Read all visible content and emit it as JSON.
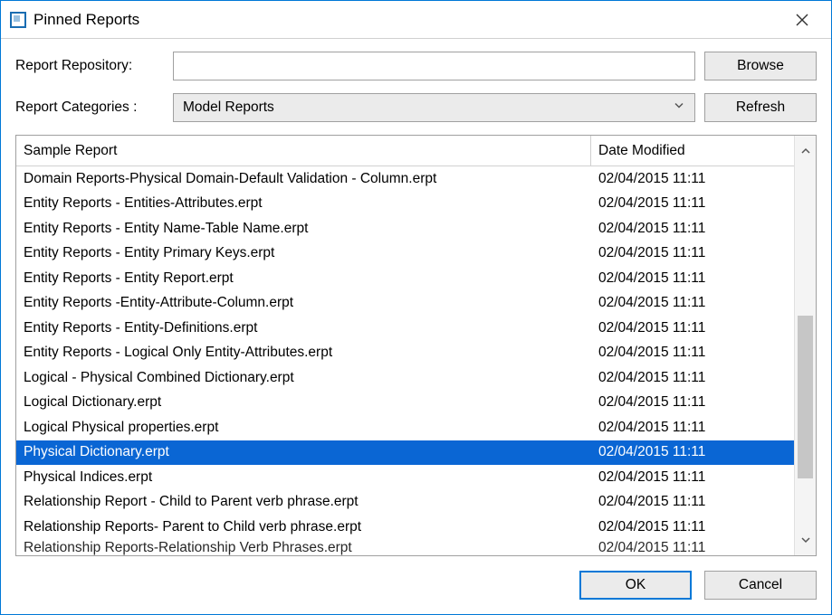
{
  "title": "Pinned Reports",
  "labels": {
    "repository": "Report Repository:",
    "categories": "Report Categories :"
  },
  "repository_value": "",
  "category_selected": "Model Reports",
  "buttons": {
    "browse": "Browse",
    "refresh": "Refresh",
    "ok": "OK",
    "cancel": "Cancel"
  },
  "columns": {
    "name": "Sample Report",
    "date": "Date Modified"
  },
  "rows": [
    {
      "name": "Domain Reports-Physical Domain-Default Validation - Column.erpt",
      "date": "02/04/2015 11:11",
      "selected": false
    },
    {
      "name": "Entity Reports - Entities-Attributes.erpt",
      "date": "02/04/2015 11:11",
      "selected": false
    },
    {
      "name": "Entity Reports - Entity Name-Table Name.erpt",
      "date": "02/04/2015 11:11",
      "selected": false
    },
    {
      "name": "Entity Reports - Entity Primary Keys.erpt",
      "date": "02/04/2015 11:11",
      "selected": false
    },
    {
      "name": "Entity Reports - Entity Report.erpt",
      "date": "02/04/2015 11:11",
      "selected": false
    },
    {
      "name": "Entity Reports  -Entity-Attribute-Column.erpt",
      "date": "02/04/2015 11:11",
      "selected": false
    },
    {
      "name": "Entity Reports - Entity-Definitions.erpt",
      "date": "02/04/2015 11:11",
      "selected": false
    },
    {
      "name": "Entity Reports - Logical Only Entity-Attributes.erpt",
      "date": "02/04/2015 11:11",
      "selected": false
    },
    {
      "name": "Logical - Physical Combined Dictionary.erpt",
      "date": "02/04/2015 11:11",
      "selected": false
    },
    {
      "name": "Logical Dictionary.erpt",
      "date": "02/04/2015 11:11",
      "selected": false
    },
    {
      "name": "Logical Physical properties.erpt",
      "date": "02/04/2015 11:11",
      "selected": false
    },
    {
      "name": "Physical Dictionary.erpt",
      "date": "02/04/2015 11:11",
      "selected": true
    },
    {
      "name": "Physical Indices.erpt",
      "date": "02/04/2015 11:11",
      "selected": false
    },
    {
      "name": "Relationship Report - Child to Parent verb phrase.erpt",
      "date": "02/04/2015 11:11",
      "selected": false
    },
    {
      "name": "Relationship Reports- Parent to Child verb phrase.erpt",
      "date": "02/04/2015 11:11",
      "selected": false
    }
  ],
  "clipped_row": {
    "name": "Relationship Reports-Relationship Verb Phrases.erpt",
    "date": "02/04/2015 11:11"
  }
}
